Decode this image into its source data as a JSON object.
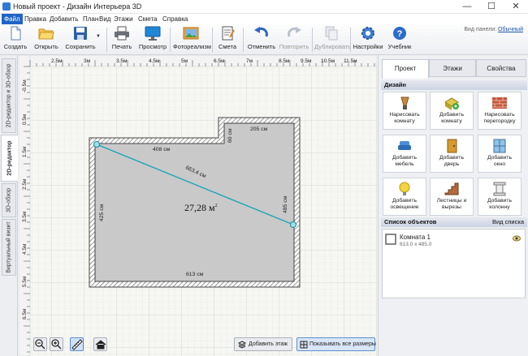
{
  "window": {
    "title": "Новый проект - Дизайн Интерьера 3D",
    "minimize": "—",
    "maximize": "☐",
    "close": "✕"
  },
  "menu": [
    "Файл",
    "Правка",
    "Добавить",
    "План",
    "Вид",
    "Этажи",
    "Смета",
    "Справка"
  ],
  "toolbar": {
    "buttons": [
      "Создать",
      "Открыть",
      "Сохранить",
      "Печать",
      "Просмотр",
      "Фотореализм",
      "Смета",
      "Отменить",
      "Повторить",
      "Дублировать",
      "Настройки",
      "Учебник"
    ],
    "panel_mode_label": "Вид панели:",
    "panel_mode_value": "Обычный"
  },
  "left_tabs": [
    "2D-редактор и 3D-обзор",
    "2D-редактор",
    "3D-обзор",
    "Виртуальный визит"
  ],
  "ruler": {
    "top": [
      "2.5м",
      "3м",
      "3.5м",
      "4.5м",
      "5м",
      "6.5м",
      "7м",
      "8.5м",
      "9.5м",
      "10.5м",
      "11.5м"
    ],
    "left": [
      "-0.5м",
      "0.5м",
      "1.5м",
      "2.5м",
      "3.5м",
      "4.5м",
      "5.5м",
      "6.5м"
    ]
  },
  "plan": {
    "dims": {
      "top_left": "408 см",
      "top_right": "205 см",
      "notch": "60 см",
      "left": "425 см",
      "right": "485 см",
      "bottom": "613 см",
      "diagonal": "663,4 см"
    },
    "area_value": "27,28 м",
    "area_sup": "2"
  },
  "canvas_buttons": {
    "add_floor": "Добавить этаж",
    "show_sizes": "Показывать все размеры"
  },
  "right_panel": {
    "tabs": [
      "Проект",
      "Этажи",
      "Свойства"
    ],
    "design_header": "Дизайн",
    "tools": [
      [
        "Нарисовать",
        "комнату"
      ],
      [
        "Добавить",
        "комнату"
      ],
      [
        "Нарисовать",
        "перегородку"
      ],
      [
        "Добавить",
        "мебель"
      ],
      [
        "Добавить",
        "дверь"
      ],
      [
        "Добавить",
        "окно"
      ],
      [
        "Добавить",
        "освещение"
      ],
      [
        "Лестницы и",
        "вырезы"
      ],
      [
        "Добавить",
        "колонну"
      ]
    ],
    "objects_header": "Список объектов",
    "objects_view_link": "Вид списка",
    "objects": [
      {
        "name": "Комната 1",
        "size": "613.0 x 485.0"
      }
    ]
  },
  "colors": {
    "accent": "#1e64c8",
    "room_fill": "#c9c9c9",
    "measure_line": "#1aa6b7"
  },
  "icons": [
    "new-file-icon",
    "folder-open-icon",
    "floppy-disk-icon",
    "printer-icon",
    "monitor-icon",
    "photo-icon",
    "notepad-icon",
    "undo-icon",
    "redo-icon",
    "duplicate-icon",
    "gear-icon",
    "help-icon"
  ]
}
